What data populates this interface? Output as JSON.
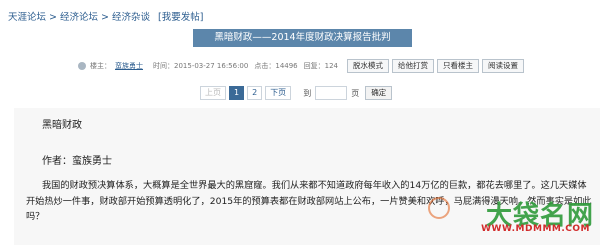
{
  "breadcrumb": {
    "items": [
      "天涯论坛",
      "经济论坛",
      "经济杂谈"
    ],
    "separator": ">",
    "post_link": "[我要发帖]"
  },
  "post_title": "黑暗财政——2014年度财政决算报告批判",
  "meta": {
    "author_label": "楼主：",
    "author": "蛮族勇士",
    "time": "时间：2015-03-27 16:56:00",
    "clicks": "点击：14496",
    "replies": "回复：124",
    "buttons": [
      "脱水模式",
      "给他打赏",
      "只看楼主",
      "阅读设置"
    ]
  },
  "pagination": {
    "prev": "上页",
    "pages": [
      "1",
      "2"
    ],
    "current": "1",
    "next": "下页",
    "goto_label": "到",
    "goto_value": "",
    "goto_page_suffix": "页",
    "confirm": "确定"
  },
  "content": {
    "title": "黑暗财政",
    "author_line": "作者：蛮族勇士",
    "body": "我国的财政预决算体系，大概算是全世界最大的黑窟窿。我们从来都不知道政府每年收入的14万亿的巨款，都花去哪里了。这几天媒体开始热炒一件事，财政部开始预算透明化了，2015年的预算表都在财政部网站上公布，一片赞美和欢呼，马屁满得漫天响。然而事实是如此吗？"
  },
  "watermark": {
    "main": "大袋名网",
    "url": "WWW.MDMMM.COM"
  },
  "colors": {
    "link": "#2c5d8f",
    "title_bar": "#5c86ab",
    "current_page": "#3b6a97",
    "content_bg": "#f7f7f7"
  }
}
